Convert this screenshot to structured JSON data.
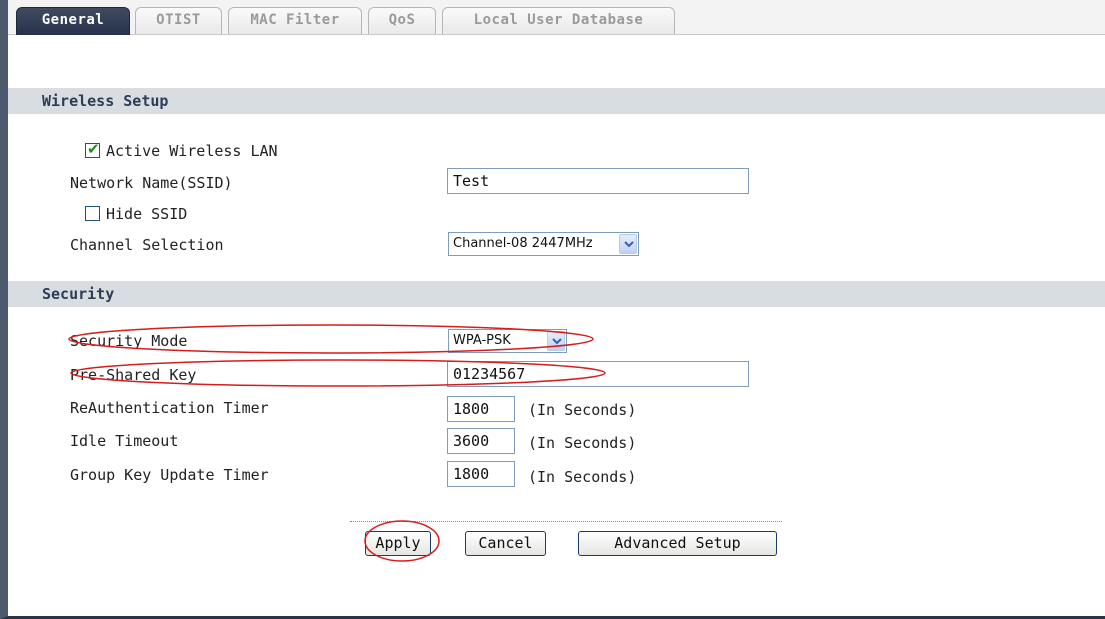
{
  "tabs": [
    {
      "label": "General",
      "active": true
    },
    {
      "label": "OTIST",
      "active": false
    },
    {
      "label": "MAC Filter",
      "active": false
    },
    {
      "label": "QoS",
      "active": false
    },
    {
      "label": "Local User Database",
      "active": false
    }
  ],
  "wireless_setup": {
    "section_title": "Wireless Setup",
    "active_wireless_lan": {
      "label": "Active Wireless LAN",
      "checked": true
    },
    "ssid": {
      "label": "Network Name(SSID)",
      "value": "Test"
    },
    "hide_ssid": {
      "label": "Hide SSID",
      "checked": false
    },
    "channel": {
      "label": "Channel Selection",
      "value": "Channel-08 2447MHz"
    }
  },
  "security": {
    "section_title": "Security",
    "mode": {
      "label": "Security Mode",
      "value": "WPA-PSK"
    },
    "psk": {
      "label": "Pre-Shared Key",
      "value": "01234567"
    },
    "reauth_timer": {
      "label": "ReAuthentication Timer",
      "value": "1800",
      "unit": "(In Seconds)"
    },
    "idle_timeout": {
      "label": "Idle Timeout",
      "value": "3600",
      "unit": "(In Seconds)"
    },
    "group_key_timer": {
      "label": "Group Key Update Timer",
      "value": "1800",
      "unit": "(In Seconds)"
    }
  },
  "buttons": {
    "apply": "Apply",
    "cancel": "Cancel",
    "advanced": "Advanced Setup"
  },
  "colors": {
    "active_tab": "#27324a",
    "section_bar": "#d7dde1",
    "annotation": "#d61c1c",
    "checkmark": "#1e8c1e"
  },
  "icons": [
    "checkmark-icon",
    "chevron-down-icon"
  ]
}
